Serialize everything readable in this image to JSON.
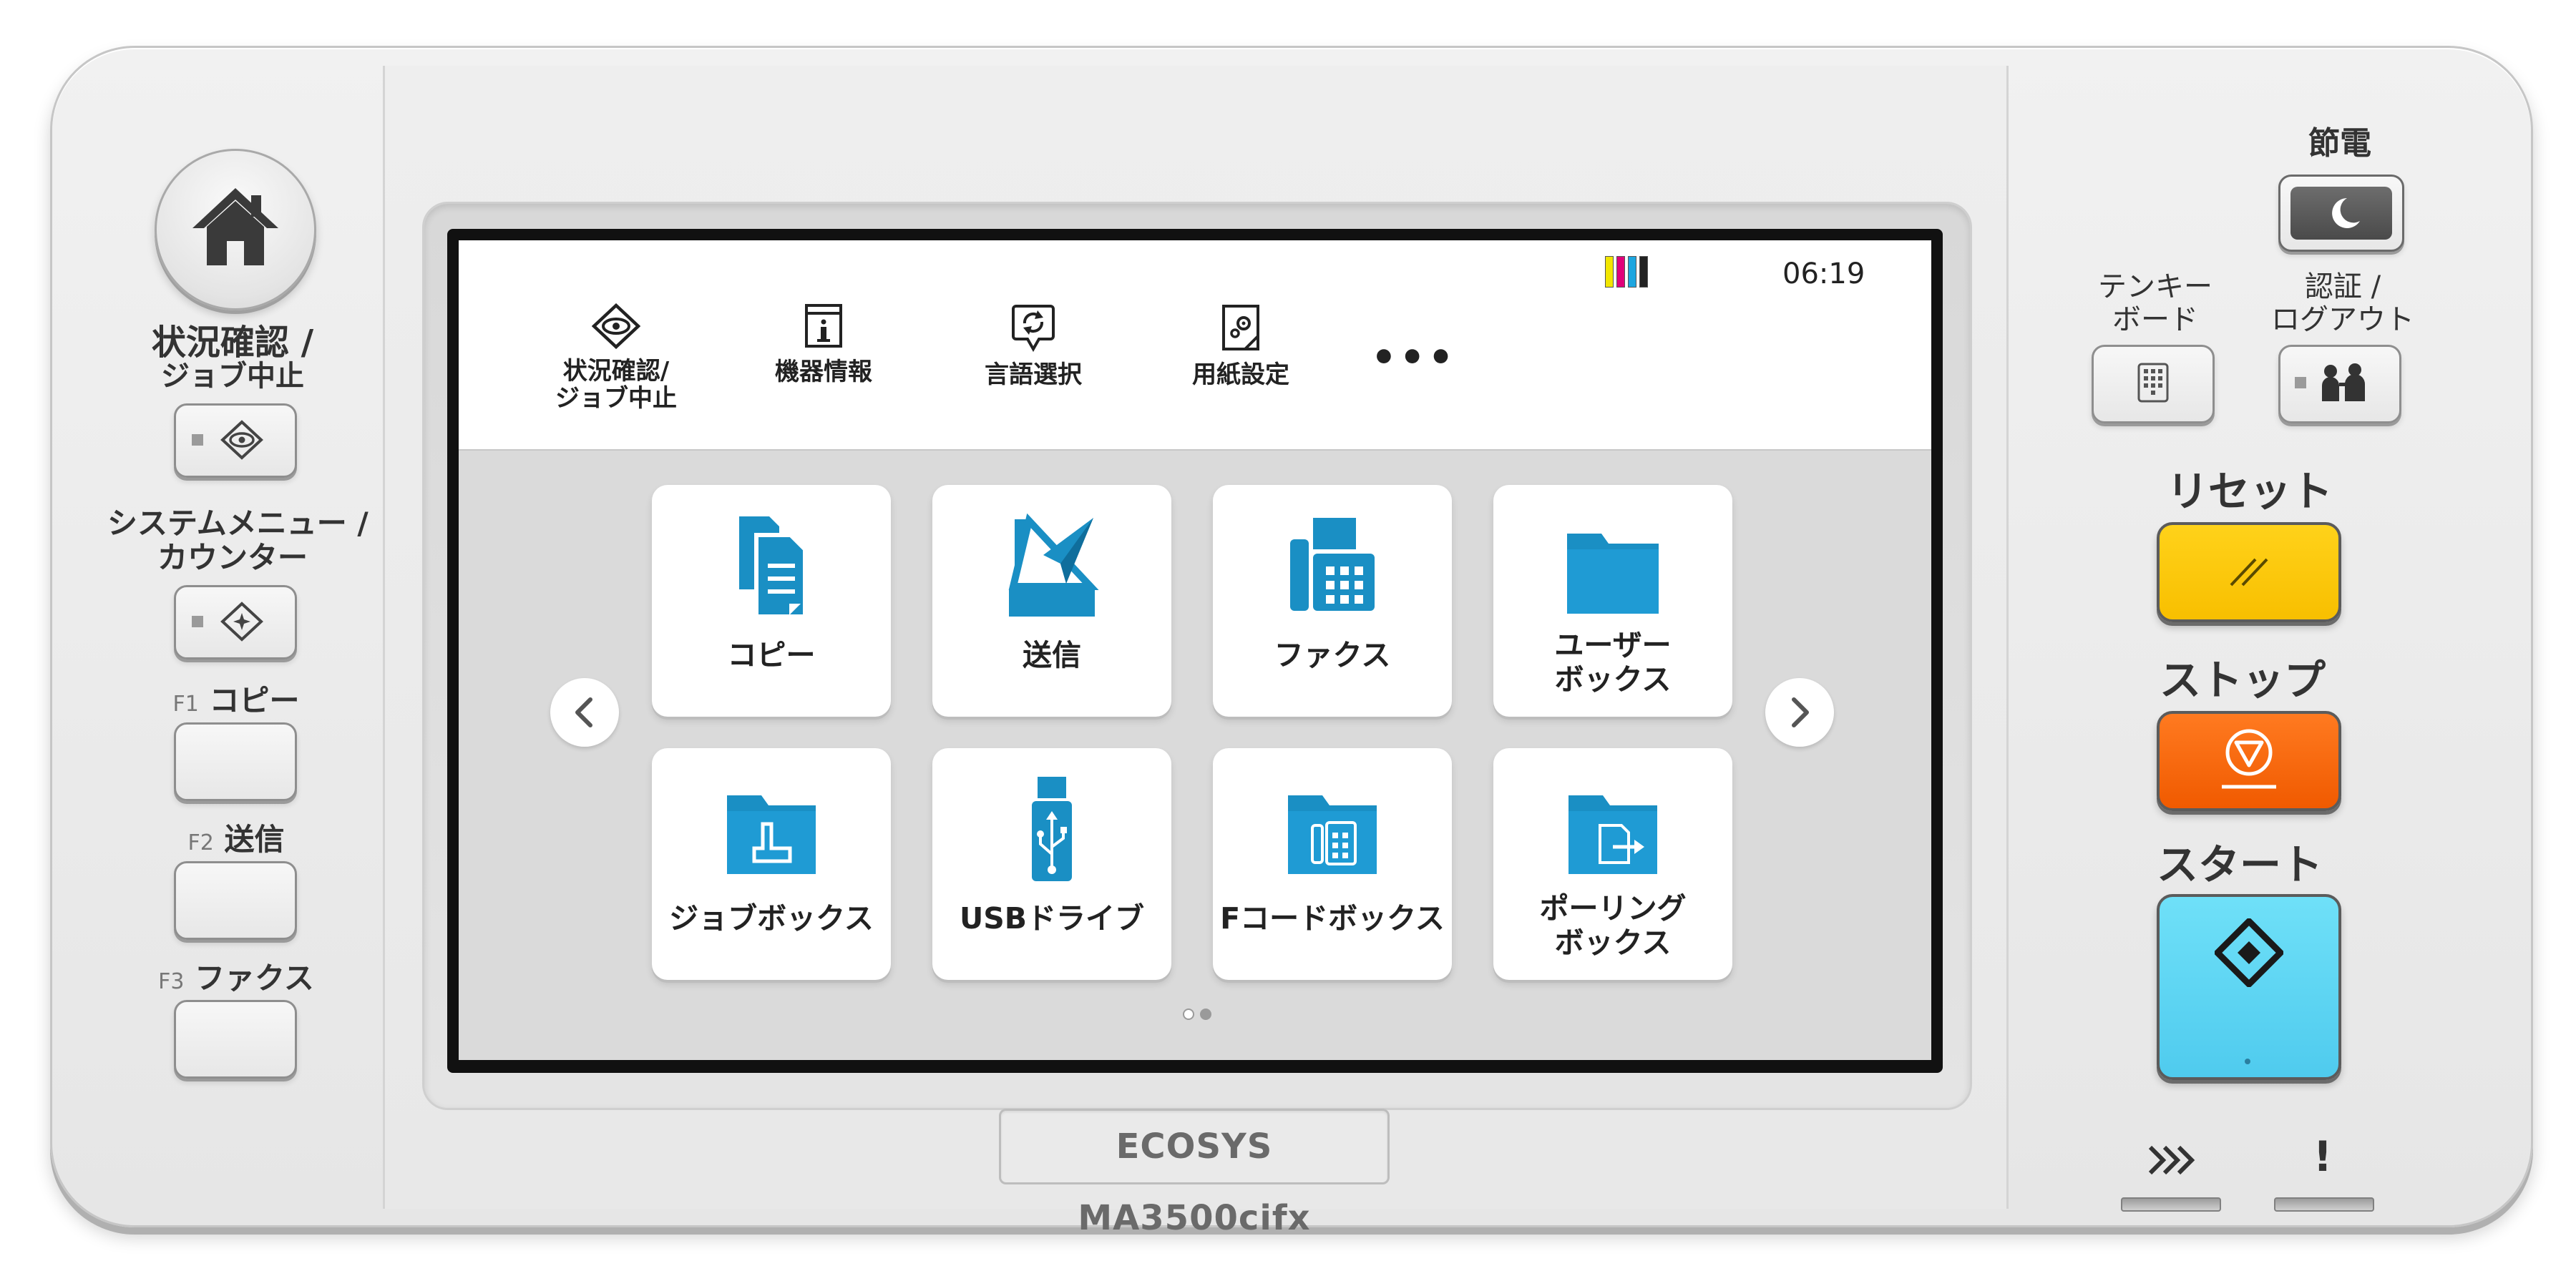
{
  "panel": {
    "model_name": "ECOSYS MA3500cifx"
  },
  "left_column": {
    "status_label_line1": "状況確認 /",
    "status_label_line2": "ジョブ中止",
    "system_menu_label_line1": "システムメニュー /",
    "system_menu_label_line2": "カウンター",
    "f1_prefix": "F1",
    "f1_label": "コピー",
    "f2_prefix": "F2",
    "f2_label": "送信",
    "f3_prefix": "F3",
    "f3_label": "ファクス"
  },
  "screen": {
    "clock": "06:19",
    "toner_colors": [
      "#f2e600",
      "#e0007a",
      "#1da6e0",
      "#222222"
    ],
    "header_items": [
      {
        "icon": "status-icon",
        "label_line1": "状況確認/",
        "label_line2": "ジョブ中止"
      },
      {
        "icon": "device-info-icon",
        "label_line1": "機器情報",
        "label_line2": ""
      },
      {
        "icon": "language-icon",
        "label_line1": "言語選択",
        "label_line2": ""
      },
      {
        "icon": "paper-settings-icon",
        "label_line1": "用紙設定",
        "label_line2": ""
      }
    ],
    "more": "•••",
    "tiles": [
      {
        "label": "コピー",
        "icon": "copy-icon"
      },
      {
        "label": "送信",
        "icon": "send-icon"
      },
      {
        "label": "ファクス",
        "icon": "fax-icon"
      },
      {
        "label": "ユーザー\nボックス",
        "icon": "user-box-icon"
      },
      {
        "label": "ジョブボックス",
        "icon": "job-box-icon"
      },
      {
        "label": "USBドライブ",
        "icon": "usb-drive-icon"
      },
      {
        "label": "Fコードボックス",
        "icon": "fcode-box-icon"
      },
      {
        "label": "ポーリング\nボックス",
        "icon": "polling-box-icon"
      }
    ],
    "page_indicator": {
      "current": 2,
      "total": 2
    },
    "accent_color": "#1a8fc4"
  },
  "right_column": {
    "energy_saver_label": "節電",
    "tenkey_label_line1": "テンキー",
    "tenkey_label_line2": "ボード",
    "auth_label_line1": "認証 /",
    "auth_label_line2": "ログアウト",
    "reset_label": "リセット",
    "stop_label": "ストップ",
    "start_label": "スタート",
    "processing_symbol": "⯮⯮",
    "attention_symbol": "!",
    "reset_color": "#f8bf00",
    "stop_color": "#f05a00",
    "start_color": "#4fcbee"
  }
}
